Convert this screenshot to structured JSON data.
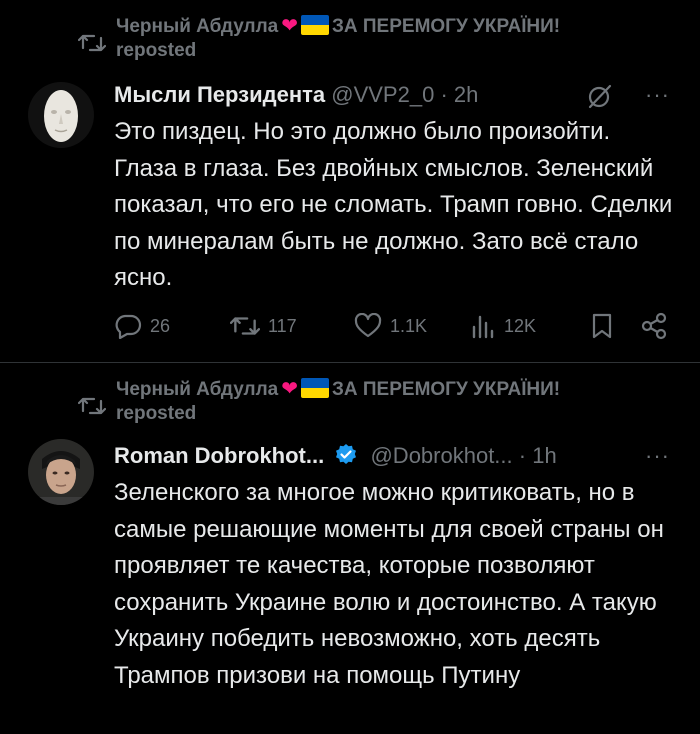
{
  "tweets": [
    {
      "repost": {
        "user": "Черный Абдулла",
        "banner": "ЗА ПЕРЕМОГУ УКРАЇНИ!",
        "label": "reposted"
      },
      "author_name": "Мысли Перзидента",
      "handle": "@VVP2_0",
      "time": "· 2h",
      "text": "Это пиздец. Но это должно было произойти. Глаза в глаза. Без двойных смыслов. Зеленский показал, что его не сломать. Трамп говно. Сделки по минералам быть не должно. Зато всё стало ясно.",
      "stats": {
        "replies": "26",
        "reposts": "117",
        "likes": "1.1K",
        "views": "12K"
      }
    },
    {
      "repost": {
        "user": "Черный Абдулла",
        "banner": "ЗА ПЕРЕМОГУ УКРАЇНИ!",
        "label": "reposted"
      },
      "author_name": "Roman Dobrokhot...",
      "handle": "@Dobrokhot...",
      "time": "· 1h",
      "text": "Зеленского за многое можно критиковать, но в самые решающие моменты для своей страны он проявляет те качества, которые позволяют сохранить Украине волю и достоинство. А такую Украину победить невозможно, хоть десять Трампов призови на помощь Путину"
    }
  ],
  "colors": {
    "background": "#000000",
    "text": "#e7e9ea",
    "muted": "#71767b",
    "verified": "#1d9bf0",
    "heart": "#f91880",
    "flag_blue": "#0057b7",
    "flag_yellow": "#ffd700"
  },
  "icons": [
    "repost-icon",
    "heart-emoji",
    "ukraine-flag-emoji",
    "grok-icon",
    "more-icon",
    "reply-icon",
    "like-icon",
    "views-icon",
    "bookmark-icon",
    "share-icon",
    "verified-badge-icon"
  ]
}
